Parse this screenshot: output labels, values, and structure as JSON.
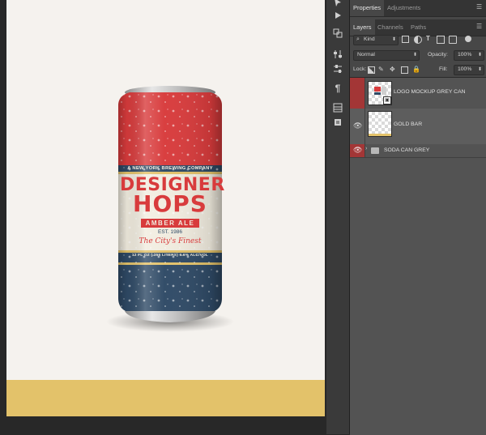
{
  "document": {
    "can": {
      "top_line": "A NEW YORK BREWING COMPANY",
      "brand_line1": "DESIGNER",
      "brand_line2": "HOPS",
      "style": "AMBER ALE",
      "est": "EST. 1986",
      "tagline": "The City's Finest",
      "bottom_line": "12 FL OZ (.355 LITERS) 6.6% ALC/VOL"
    },
    "colors": {
      "can_red": "#d83b3c",
      "can_navy": "#2f4a66",
      "can_cream": "#f1ecdf",
      "gold": "#e3c26a",
      "canvas_bg": "#f5f2ee"
    }
  },
  "tools": [
    {
      "icon": "move-arrow-icon"
    },
    {
      "icon": "play-icon"
    },
    {
      "icon": "transform-icon"
    },
    {
      "icon": "adjust-icon"
    },
    {
      "icon": "paragraph-icon"
    },
    {
      "icon": "grid-icon"
    },
    {
      "icon": "layers-mini-icon"
    }
  ],
  "panel": {
    "tabs_top": {
      "properties": "Properties",
      "adjustments": "Adjustments"
    },
    "tabs_layers": {
      "layers": "Layers",
      "channels": "Channels",
      "paths": "Paths"
    },
    "filter_kind": "Kind",
    "blend_mode": "Normal",
    "opacity_label": "Opacity:",
    "opacity_value": "100%",
    "lock_label": "Lock:",
    "fill_label": "Fill:",
    "fill_value": "100%",
    "layers": [
      {
        "name": "LOGO MOCKUP GREY CAN",
        "type": "smart-object"
      },
      {
        "name": "GOLD BAR",
        "type": "pixel"
      },
      {
        "name": "SODA CAN GREY",
        "type": "group"
      }
    ]
  }
}
